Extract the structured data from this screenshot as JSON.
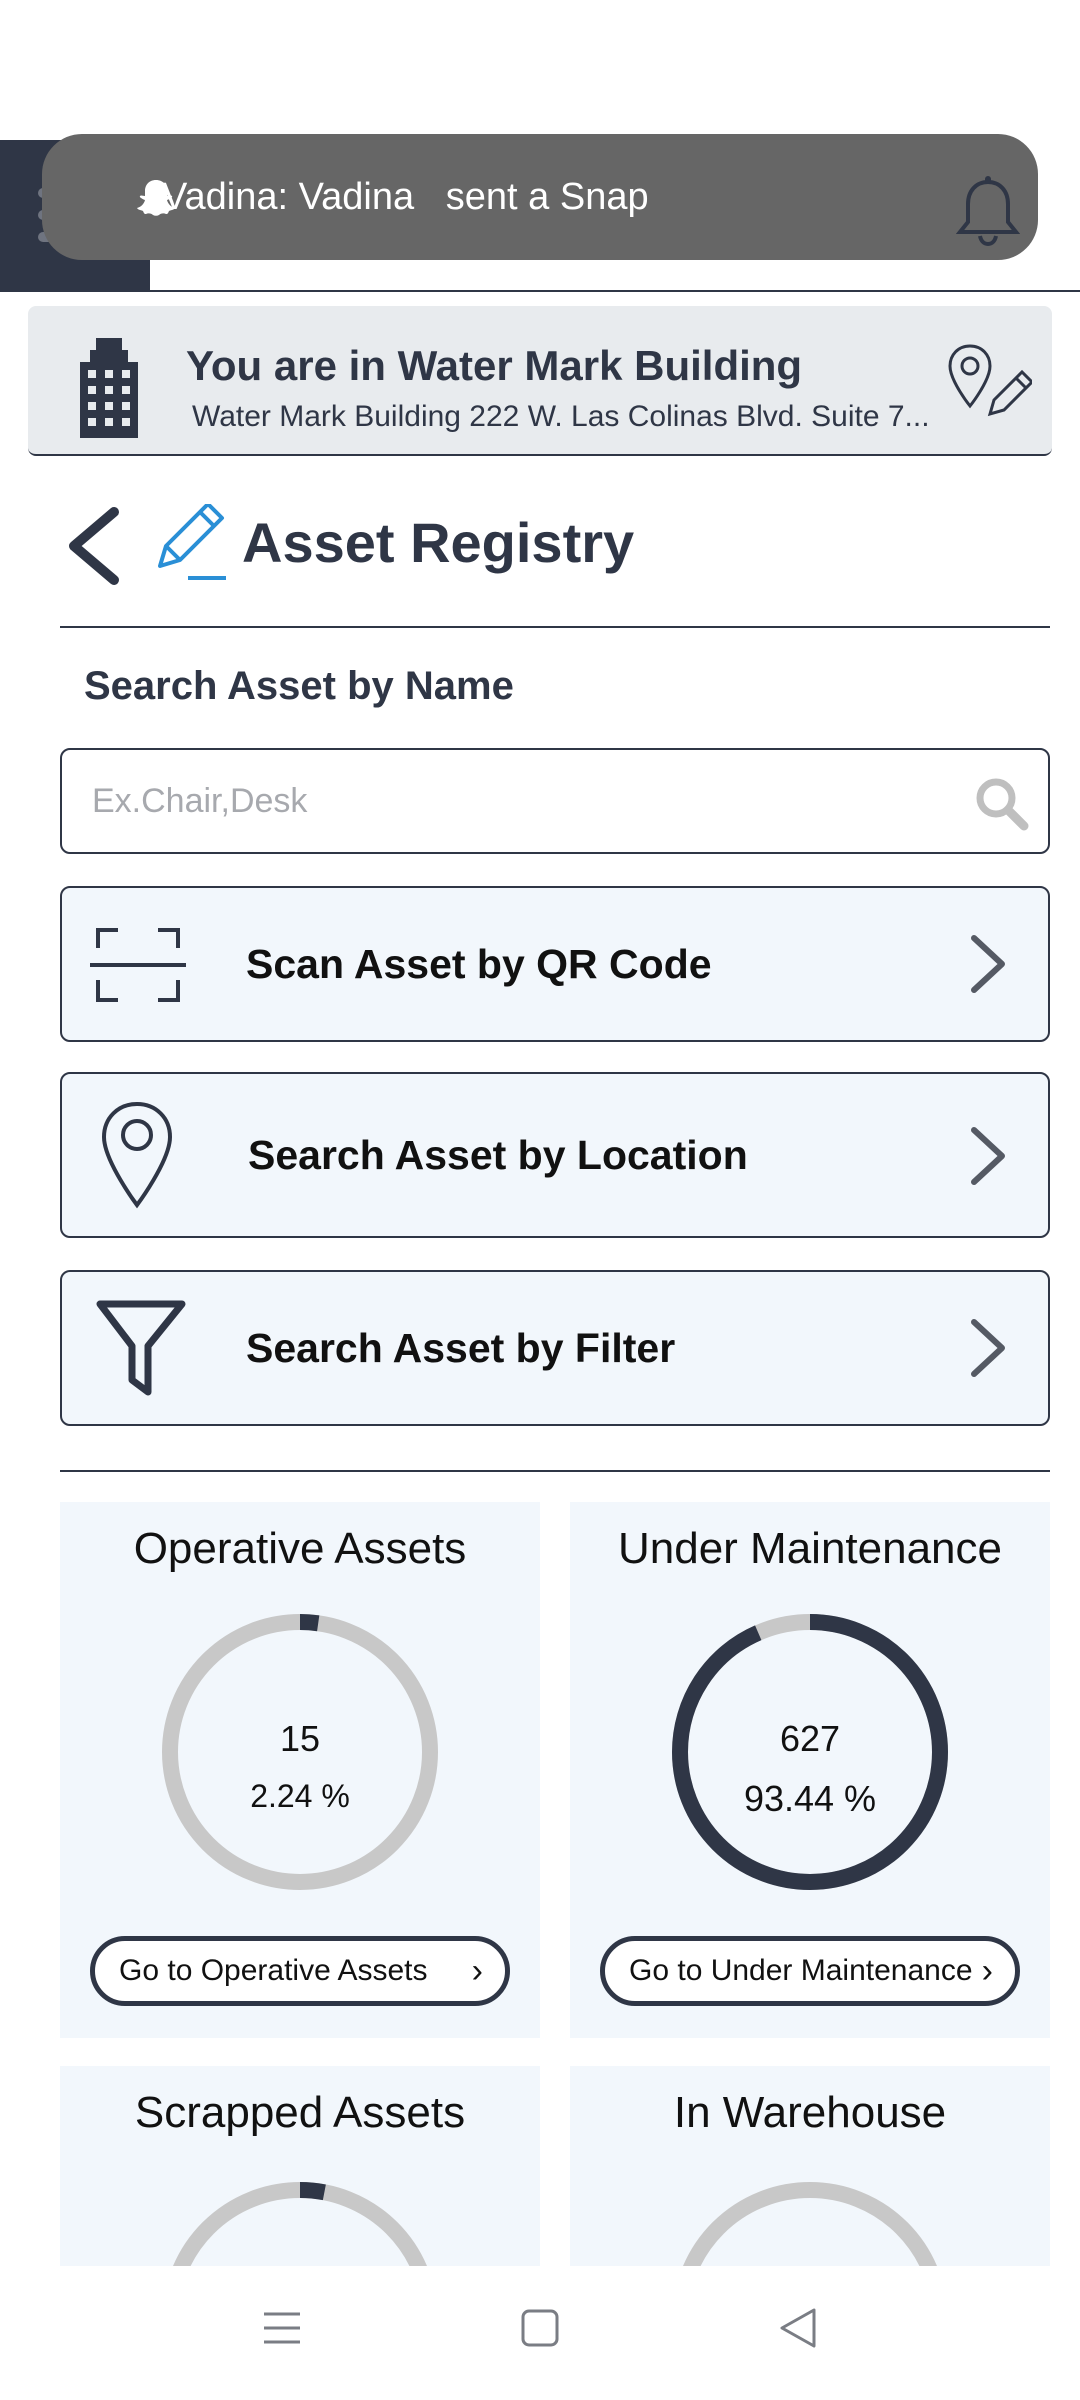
{
  "notification": {
    "text": "Vadina: Vadina   sent a Snap"
  },
  "location": {
    "title": "You are in Water Mark  Building",
    "address": "Water Mark  Building 222 W. Las Colinas Blvd. Suite 7..."
  },
  "page": {
    "title": "Asset Registry"
  },
  "search": {
    "label": "Search Asset by Name",
    "placeholder": "Ex.Chair,Desk",
    "value": ""
  },
  "options": [
    {
      "label": "Scan Asset by QR Code",
      "icon": "qr-scan-icon"
    },
    {
      "label": "Search Asset by Location",
      "icon": "location-pin-icon"
    },
    {
      "label": "Search Asset by Filter",
      "icon": "filter-icon"
    }
  ],
  "stats": [
    {
      "title": "Operative Assets",
      "count": "15",
      "percent": "2.24 %",
      "fraction": 0.0224,
      "button": "Go to Operative Assets"
    },
    {
      "title": "Under Maintenance",
      "count": "627",
      "percent": "93.44 %",
      "fraction": 0.9344,
      "button": "Go to Under Maintenance"
    },
    {
      "title": "Scrapped Assets",
      "fraction": 0.03
    },
    {
      "title": "In Warehouse",
      "fraction": 0.0
    }
  ],
  "colors": {
    "primary": "#2f3646",
    "card_bg": "#f2f7fc",
    "ring_track": "#c8c8c8",
    "accent_pencil": "#2a8fd6"
  }
}
